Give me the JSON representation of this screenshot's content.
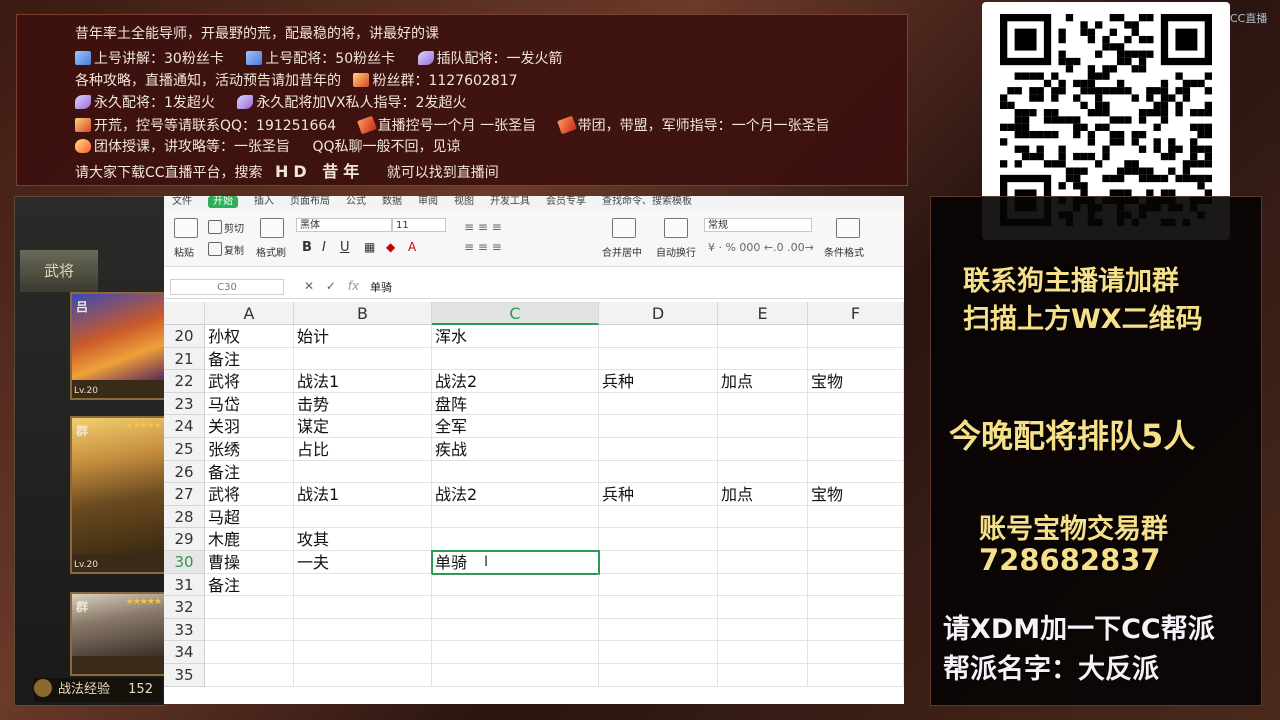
{
  "top_panel": {
    "line1": "昔年率土全能导师，开最野的荒，配最稳的将，讲最好的课",
    "line2a": "上号讲解：30粉丝卡",
    "line2b": "上号配将：50粉丝卡",
    "line2c": "插队配将：一发火箭",
    "line3a": "各种攻略，直播通知，活动预告请加昔年的",
    "line3b": "粉丝群：1127602817",
    "line4a": "永久配将：1发超火",
    "line4b": "永久配将加VX私人指导：2发超火",
    "line5a": "开荒，控号等请联系QQ：191251664",
    "line5b": "直播控号一个月 一张圣旨",
    "line5c": "带团，带盟，军师指导：一个月一张圣旨",
    "line6a": "团体授课，讲攻略等：一张圣旨",
    "line6b": "QQ私聊一般不回，见谅",
    "line7a": "请大家下载CC直播平台，搜索",
    "line7b": "HD 昔年",
    "line7c": "就可以找到直播间"
  },
  "game": {
    "tab_label": "武将",
    "cards": [
      {
        "faction": "吕",
        "level": "Lv.20"
      },
      {
        "faction": "群",
        "level": "Lv.20"
      },
      {
        "faction": "群",
        "level": ""
      }
    ],
    "skill_exp_label": "战法经验",
    "skill_exp_value": "152"
  },
  "spreadsheet": {
    "ribbon_tabs": [
      "文件",
      "开始",
      "插入",
      "页面布局",
      "公式",
      "数据",
      "审阅",
      "视图",
      "开发工具",
      "会员专享",
      "查找命令、搜索模板"
    ],
    "active_tab_index": 1,
    "ribbon": {
      "cut": "剪切",
      "paste": "粘贴",
      "copy": "复制",
      "format_painter": "格式刷",
      "font_name": "黑体",
      "font_size": "11",
      "bold": "B",
      "italic": "I",
      "underline": "U",
      "merge_center": "合并居中",
      "wrap": "自动换行",
      "number_format": "常规",
      "conditional_format": "条件格式"
    },
    "name_box": "C30",
    "formula_value": "单骑",
    "columns": [
      "A",
      "B",
      "C",
      "D",
      "E",
      "F"
    ],
    "active_column": "C",
    "rows": [
      {
        "num": "20",
        "cells": [
          "孙权",
          "始计",
          "浑水",
          "",
          "",
          ""
        ]
      },
      {
        "num": "21",
        "cells": [
          "备注",
          "",
          "",
          "",
          "",
          ""
        ]
      },
      {
        "num": "22",
        "cells": [
          "武将",
          "战法1",
          "战法2",
          "兵种",
          "加点",
          "宝物"
        ]
      },
      {
        "num": "23",
        "cells": [
          "马岱",
          "击势",
          "盘阵",
          "",
          "",
          ""
        ]
      },
      {
        "num": "24",
        "cells": [
          "关羽",
          "谋定",
          "全军",
          "",
          "",
          ""
        ]
      },
      {
        "num": "25",
        "cells": [
          "张绣",
          "占比",
          "疾战",
          "",
          "",
          ""
        ]
      },
      {
        "num": "26",
        "cells": [
          "备注",
          "",
          "",
          "",
          "",
          ""
        ]
      },
      {
        "num": "27",
        "cells": [
          "武将",
          "战法1",
          "战法2",
          "兵种",
          "加点",
          "宝物"
        ]
      },
      {
        "num": "28",
        "cells": [
          "马超",
          "",
          "",
          "",
          "",
          ""
        ]
      },
      {
        "num": "29",
        "cells": [
          "木鹿",
          "攻其",
          "",
          "",
          "",
          ""
        ]
      },
      {
        "num": "30",
        "cells": [
          "曹操",
          "一夫",
          "单骑",
          "",
          "",
          ""
        ]
      },
      {
        "num": "31",
        "cells": [
          "备注",
          "",
          "",
          "",
          "",
          ""
        ]
      },
      {
        "num": "32",
        "cells": [
          "",
          "",
          "",
          "",
          "",
          ""
        ]
      },
      {
        "num": "33",
        "cells": [
          "",
          "",
          "",
          "",
          "",
          ""
        ]
      },
      {
        "num": "34",
        "cells": [
          "",
          "",
          "",
          "",
          "",
          ""
        ]
      },
      {
        "num": "35",
        "cells": [
          "",
          "",
          "",
          "",
          "",
          ""
        ]
      }
    ],
    "active_row": "30"
  },
  "right_panel": {
    "watermark": "CC直播",
    "line1": "联系狗主播请加群",
    "line2": "扫描上方WX二维码",
    "queue": "今晚配将排队5人",
    "trade_label": "账号宝物交易群",
    "trade_number": "728682837",
    "cc_line1": "请XDM加一下CC帮派",
    "cc_line2": "帮派名字：大反派"
  },
  "colors": {
    "accent_green": "#2a9a54",
    "panel_gold": "#f6e08a",
    "top_panel_bg": "#3c100e"
  }
}
